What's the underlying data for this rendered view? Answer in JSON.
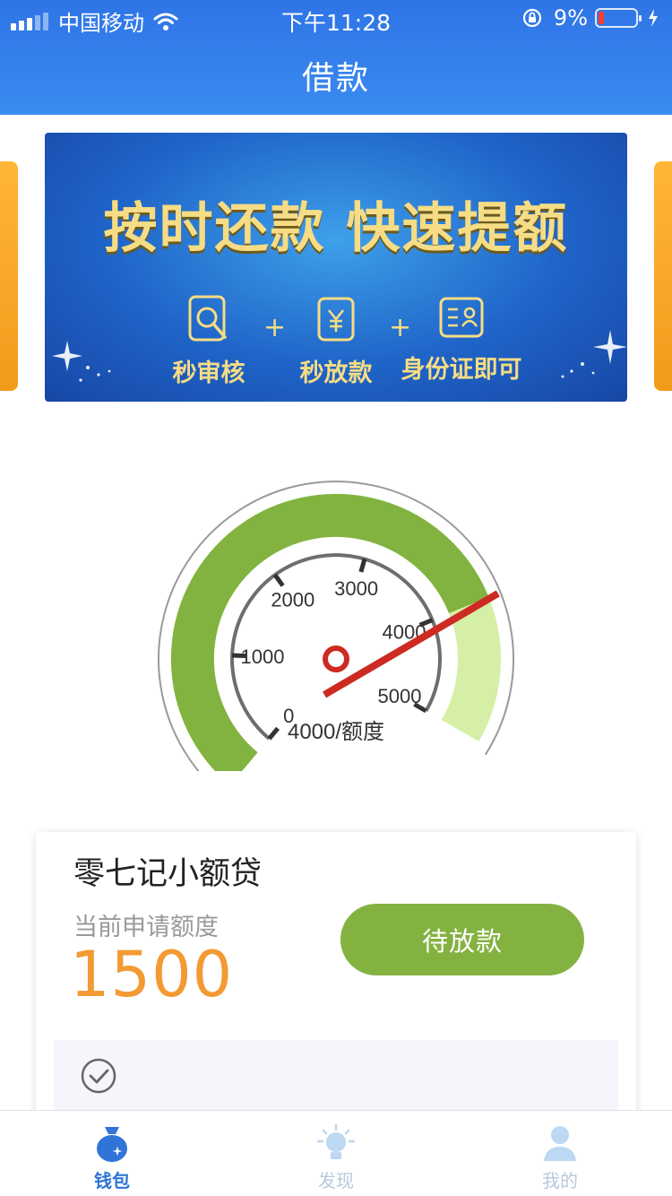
{
  "status_bar": {
    "carrier": "中国移动",
    "time": "下午11:28",
    "battery": "9%"
  },
  "header": {
    "title": "借款"
  },
  "banner": {
    "headline": "按时还款  快速提额",
    "features": [
      {
        "label": "秒审核",
        "icon": "search-doc-icon"
      },
      {
        "label": "秒放款",
        "icon": "yuan-icon"
      },
      {
        "label": "身份证即可",
        "icon": "id-card-icon"
      }
    ],
    "plus": "+"
  },
  "gauge": {
    "ticks": [
      "0",
      "1000",
      "2000",
      "3000",
      "4000",
      "5000"
    ],
    "value": 4000,
    "max": 5000,
    "caption": "4000/额度",
    "colors": {
      "filled": "#82b340",
      "remaining": "#d6efa6",
      "needle": "#cc2a22"
    }
  },
  "loan_card": {
    "product_name": "零七记小额贷",
    "amount_label": "当前申请额度",
    "amount": "1500",
    "status_button": "待放款"
  },
  "tab_bar": {
    "tabs": [
      {
        "label": "钱包",
        "icon": "wallet-icon",
        "active": true
      },
      {
        "label": "发现",
        "icon": "lightbulb-icon",
        "active": false
      },
      {
        "label": "我的",
        "icon": "user-icon",
        "active": false
      }
    ]
  },
  "colors": {
    "header": "#2f74e6",
    "accent_orange": "#f39a33",
    "button_green": "#84b241",
    "tab_active": "#2f74d6"
  }
}
